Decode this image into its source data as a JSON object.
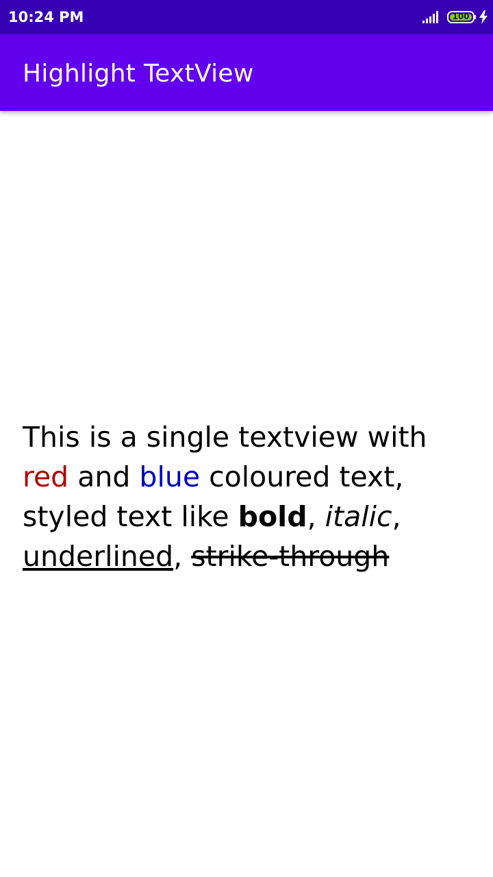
{
  "status_bar": {
    "time": "10:24 PM",
    "battery_level": "100",
    "icons": [
      "signal-icon",
      "battery-icon",
      "charging-icon"
    ]
  },
  "app_bar": {
    "title": "Highlight TextView"
  },
  "content": {
    "segments": {
      "intro": "This is a single textview with ",
      "red_word": "red",
      "and": " and ",
      "blue_word": "blue",
      "coloured": " coloured text, styled text like ",
      "bold_word": "bold",
      "comma1": ", ",
      "italic_word": "italic",
      "comma2": ", ",
      "underline_word": "underlined",
      "comma3": ", ",
      "strike_word": "strike-through"
    }
  },
  "colors": {
    "status_bar": "#3700B3",
    "app_bar": "#6200EE",
    "red": "#B00000",
    "blue": "#0000C0",
    "battery_fill": "#7ED321"
  }
}
